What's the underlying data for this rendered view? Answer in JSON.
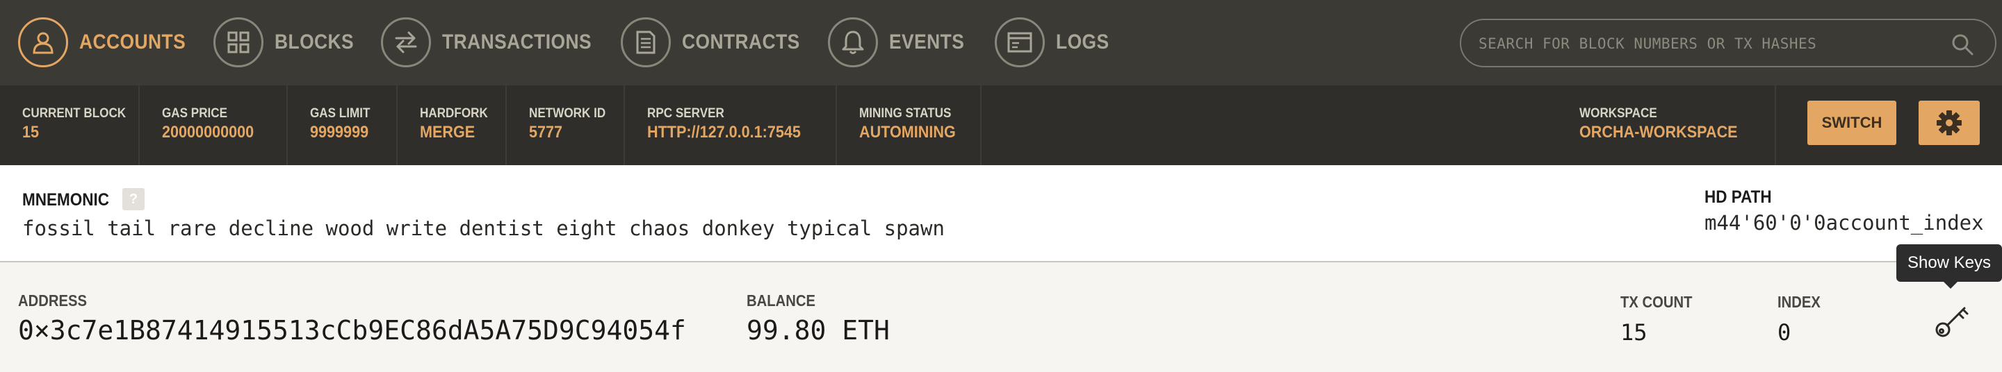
{
  "nav": {
    "items": [
      {
        "label": "ACCOUNTS",
        "icon": "user-icon",
        "active": true
      },
      {
        "label": "BLOCKS",
        "icon": "grid-icon",
        "active": false
      },
      {
        "label": "TRANSACTIONS",
        "icon": "arrows-swap-icon",
        "active": false
      },
      {
        "label": "CONTRACTS",
        "icon": "document-icon",
        "active": false
      },
      {
        "label": "EVENTS",
        "icon": "bell-icon",
        "active": false
      },
      {
        "label": "LOGS",
        "icon": "terminal-window-icon",
        "active": false
      }
    ],
    "search": {
      "placeholder": "SEARCH FOR BLOCK NUMBERS OR TX HASHES",
      "icon": "search-icon"
    }
  },
  "status": {
    "items": [
      {
        "label": "CURRENT BLOCK",
        "value": "15"
      },
      {
        "label": "GAS PRICE",
        "value": "20000000000"
      },
      {
        "label": "GAS LIMIT",
        "value": "9999999"
      },
      {
        "label": "HARDFORK",
        "value": "MERGE"
      },
      {
        "label": "NETWORK ID",
        "value": "5777"
      },
      {
        "label": "RPC SERVER",
        "value": "HTTP://127.0.0.1:7545"
      },
      {
        "label": "MINING STATUS",
        "value": "AUTOMINING"
      }
    ],
    "workspace": {
      "label": "WORKSPACE",
      "value": "ORCHA-WORKSPACE"
    },
    "switch_label": "SWITCH",
    "settings_icon": "gear-icon"
  },
  "mnemonic": {
    "title": "MNEMONIC",
    "help": "?",
    "words": "fossil tail rare decline wood write dentist eight chaos donkey typical spawn",
    "hd_path_label": "HD PATH",
    "hd_path_value": "m44'60'0'0account_index"
  },
  "account": {
    "address_label": "ADDRESS",
    "address": "0×3c7e1B87414915513cCb9EC86dA5A75D9C94054f",
    "balance_label": "BALANCE",
    "balance": "99.80 ETH",
    "tx_count_label": "TX COUNT",
    "tx_count": "15",
    "index_label": "INDEX",
    "index": "0",
    "key_icon": "key-icon"
  },
  "tooltip": {
    "text": "Show Keys"
  },
  "colors": {
    "accent": "#e4a663",
    "nav_bg": "#3b3a35",
    "status_bg": "#2f2e2a",
    "nav_inactive": "#a9a597",
    "page_bg": "#f6f5f1"
  }
}
